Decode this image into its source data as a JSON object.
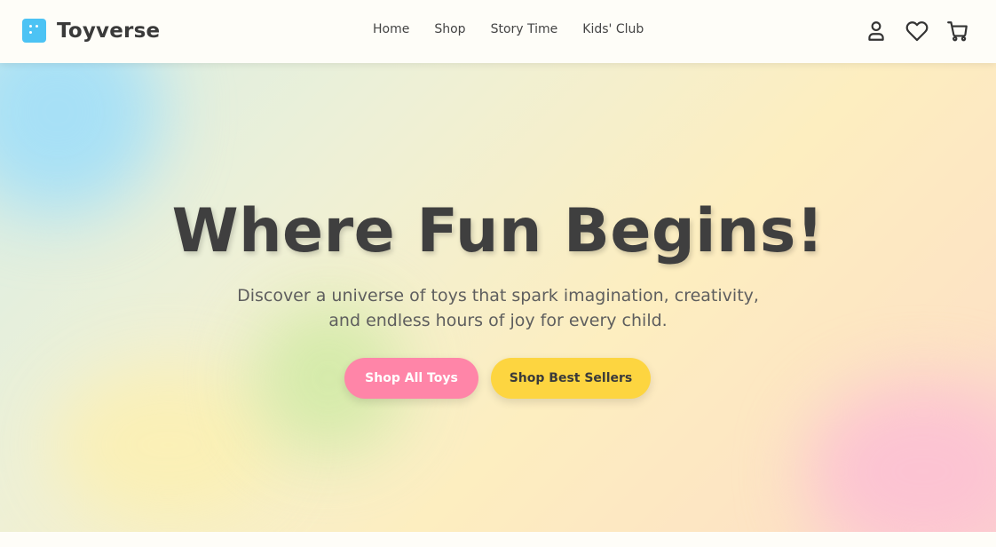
{
  "brand": {
    "name": "Toyverse",
    "logo_color": "#4cc3f4"
  },
  "nav": {
    "items": [
      {
        "label": "Home"
      },
      {
        "label": "Shop"
      },
      {
        "label": "Story Time"
      },
      {
        "label": "Kids' Club"
      }
    ],
    "icons": [
      "user-icon",
      "heart-icon",
      "cart-icon"
    ]
  },
  "hero": {
    "title": "Where Fun Begins!",
    "subtitle": "Discover a universe of toys that spark imagination, creativity, and endless hours of joy for every child.",
    "primary_button": "Shop All Toys",
    "secondary_button": "Shop Best Sellers"
  },
  "colors": {
    "primary_pink": "#ff85a8",
    "accent_yellow": "#fdd540",
    "text_dark": "#3f3f3f"
  }
}
